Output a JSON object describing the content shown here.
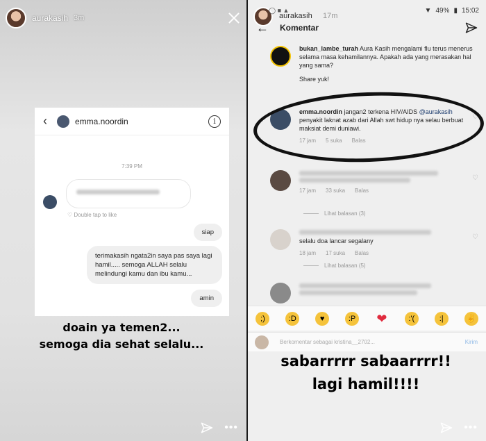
{
  "left_story": {
    "username": "aurakasih",
    "time": "3m",
    "dm": {
      "contact": "emma.noordin",
      "time": "7:39 PM",
      "like_hint": "Double tap to like",
      "messages": [
        "siap",
        "terimakasih ngata2in saya pas saya lagi hamil..... semoga ALLAH selalu melindungi kamu dan ibu kamu...",
        "amin"
      ]
    },
    "caption_line1": "doain ya temen2...",
    "caption_line2": "semoga dia sehat selalu..."
  },
  "right_story": {
    "username": "aurakasih",
    "time": "17m",
    "status": {
      "battery": "49%",
      "clock": "15:02"
    },
    "comments_title": "Komentar",
    "comments": [
      {
        "user": "bukan_lambe_turah",
        "text": "Aura Kasih mengalami flu terus menerus selama masa kehamilannya. Apakah ada yang merasakan hal yang sama?",
        "extra": "Share yuk!"
      },
      {
        "user": "emma.noordin",
        "text": "jangan2 terkena HIV/AIDS",
        "mention": "@aurakasih",
        "text2": "penyakit laknat azab dari Allah swt hidup nya selau berbuat maksiat demi duniawi.",
        "age": "17 jam",
        "likes": "5 suka",
        "reply": "Balas"
      },
      {
        "age": "17 jam",
        "likes": "33 suka",
        "reply": "Balas",
        "view_replies": "Lihat balasan (3)"
      },
      {
        "text": "selalu doa lancar segalany",
        "age": "18 jam",
        "likes": "17 suka",
        "reply": "Balas",
        "view_replies": "Lihat balasan (5)"
      }
    ],
    "input_placeholder": "Berkomentar sebagai kristina__2702...",
    "send_label": "Kirim",
    "caption_line1": "sabarrrrr sabaarrrr!!",
    "caption_line2": "lagi hamil!!!!"
  },
  "colors": {
    "mention": "#1a3a6d",
    "heart": "#e02b3e",
    "send": "#8fb9e6"
  }
}
